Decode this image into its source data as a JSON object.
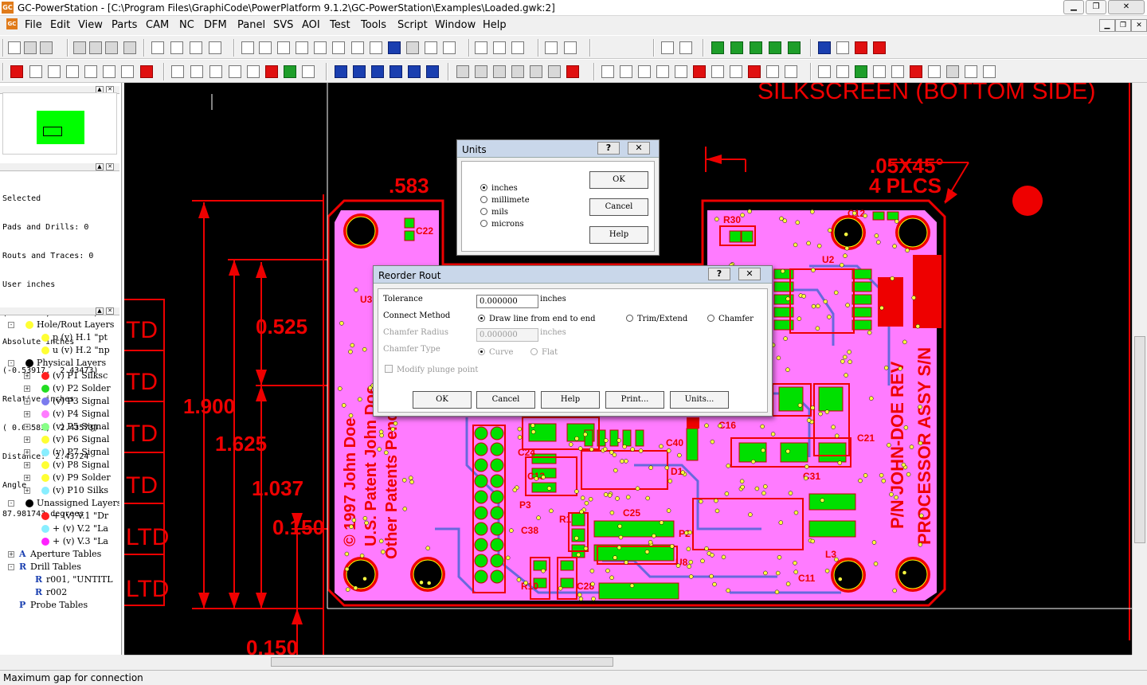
{
  "window": {
    "title": "GC-PowerStation - [C:\\Program Files\\GraphiCode\\PowerPlatform 9.1.2\\GC-PowerStation\\Examples\\Loaded.gwk:2]",
    "logo": "GC"
  },
  "menu": [
    "File",
    "Edit",
    "View",
    "Parts",
    "CAM",
    "NC",
    "DFM",
    "Panel",
    "SVS",
    "AOI",
    "Test",
    "Tools",
    "Script",
    "Window",
    "Help"
  ],
  "toolbar": {
    "units_value": "inches"
  },
  "info_panel": {
    "lines": [
      "Selected",
      "Pads and Drills: 0",
      "Routs and Traces: 0",
      "User inches",
      "(-0.53917,  2.43473)",
      "Absolute inches",
      "(-0.53917,  2.43473)",
      "Relative inches",
      "( 0.08583,  2.43573)",
      "Distance:  2.43724",
      "Angle",
      "87.981743 degrees"
    ]
  },
  "layers": [
    {
      "label": "Hole/Rout Layers",
      "color": "#ffff33",
      "level": 0,
      "exp": "-"
    },
    {
      "label": "p (v) H.1 \"pt",
      "color": "#ffff33",
      "level": 1,
      "exp": ""
    },
    {
      "label": "u (v) H.2 \"np",
      "color": "#ffff33",
      "level": 1,
      "exp": ""
    },
    {
      "label": "Physical Layers",
      "color": "#000000",
      "level": 0,
      "exp": "-"
    },
    {
      "label": "(v) P1 Silksc",
      "color": "#ff2020",
      "level": 1,
      "exp": "+"
    },
    {
      "label": "(v) P2 Solder",
      "color": "#22dd22",
      "level": 1,
      "exp": "+"
    },
    {
      "label": "(v) P3 Signal",
      "color": "#7b7bee",
      "level": 1,
      "exp": "+"
    },
    {
      "label": "(v) P4 Signal",
      "color": "#ff7bff",
      "level": 1,
      "exp": "+"
    },
    {
      "label": "(v) P5 Signal",
      "color": "#88ff88",
      "level": 1,
      "exp": "+"
    },
    {
      "label": "(v) P6 Signal",
      "color": "#ffff33",
      "level": 1,
      "exp": "+"
    },
    {
      "label": "(v) P7 Signal",
      "color": "#88eeff",
      "level": 1,
      "exp": "+"
    },
    {
      "label": "(v) P8 Signal",
      "color": "#ffff33",
      "level": 1,
      "exp": "+"
    },
    {
      "label": "(v) P9 Solder",
      "color": "#ffff33",
      "level": 1,
      "exp": "+"
    },
    {
      "label": "(v) P10 Silks",
      "color": "#88eeff",
      "level": 1,
      "exp": "+"
    },
    {
      "label": "Unassigned Layers",
      "color": "#000000",
      "level": 0,
      "exp": "-"
    },
    {
      "label": "+ (v) V.1 \"Dr",
      "color": "#ff2020",
      "level": 1,
      "exp": ""
    },
    {
      "label": "+ (v) V.2 \"La",
      "color": "#88eeff",
      "level": 1,
      "exp": ""
    },
    {
      "label": "+ (v) V.3 \"La",
      "color": "#ff22ff",
      "level": 1,
      "exp": ""
    },
    {
      "label": "Aperture Tables",
      "color": "",
      "level": 0,
      "exp": "+",
      "glyph": "A"
    },
    {
      "label": "Drill Tables",
      "color": "",
      "level": 0,
      "exp": "-",
      "glyph": "R"
    },
    {
      "label": "r001, \"UNTITL",
      "color": "",
      "level": 1,
      "exp": "",
      "glyph": "R"
    },
    {
      "label": "r002",
      "color": "",
      "level": 1,
      "exp": "",
      "glyph": "R"
    },
    {
      "label": "Probe Tables",
      "color": "",
      "level": 0,
      "exp": "",
      "glyph": "P"
    }
  ],
  "cad": {
    "dimensions": [
      "1.900",
      "1.625",
      "0.525",
      "1.037",
      "0.150",
      ".583",
      "0.150",
      ".05X45°",
      "4 PLCS"
    ],
    "top_label": "SILKSCREEN  (BOTTOM SIDE)",
    "ltd": [
      "TD",
      "TD",
      "TD",
      "TD",
      "LTD",
      "LTD"
    ],
    "silk_left": [
      "© 1997 John Doe",
      "U.S. Patent John Doe",
      "Other Patents Pend"
    ],
    "silk_right": [
      "P/N JOHN-DOE REV",
      "PROCESSOR ASSY S/N"
    ],
    "refdes": [
      "R30",
      "C22",
      "U2",
      "C12",
      "U3",
      "C24",
      "C13",
      "P3",
      "C25",
      "R1",
      "C38",
      "R10",
      "C28",
      "U8",
      "P2",
      "C11",
      "L3",
      "C31",
      "C21",
      "C40",
      "C16",
      "D1"
    ]
  },
  "units_dialog": {
    "title": "Units",
    "options": [
      "inches",
      "millimete",
      "mils",
      "microns"
    ],
    "selected": 0,
    "ok": "OK",
    "cancel": "Cancel",
    "help": "Help",
    "help_btn": "?",
    "close_btn": "✕"
  },
  "reorder_dialog": {
    "title": "Reorder Rout",
    "tolerance_label": "Tolerance",
    "tolerance_value": "0.000000",
    "tolerance_unit": "inches",
    "connect_label": "Connect Method",
    "connect_options": [
      "Draw line from end to end",
      "Trim/Extend",
      "Chamfer"
    ],
    "chamfer_radius_label": "Chamfer Radius",
    "chamfer_radius_value": "0.000000",
    "chamfer_radius_unit": "inches",
    "chamfer_type_label": "Chamfer Type",
    "chamfer_type_options": [
      "Curve",
      "Flat"
    ],
    "modify_label": "Modify plunge point",
    "buttons": [
      "OK",
      "Cancel",
      "Help",
      "Print...",
      "Units..."
    ],
    "help_btn": "?",
    "close_btn": "✕"
  },
  "status": "Maximum gap for connection"
}
